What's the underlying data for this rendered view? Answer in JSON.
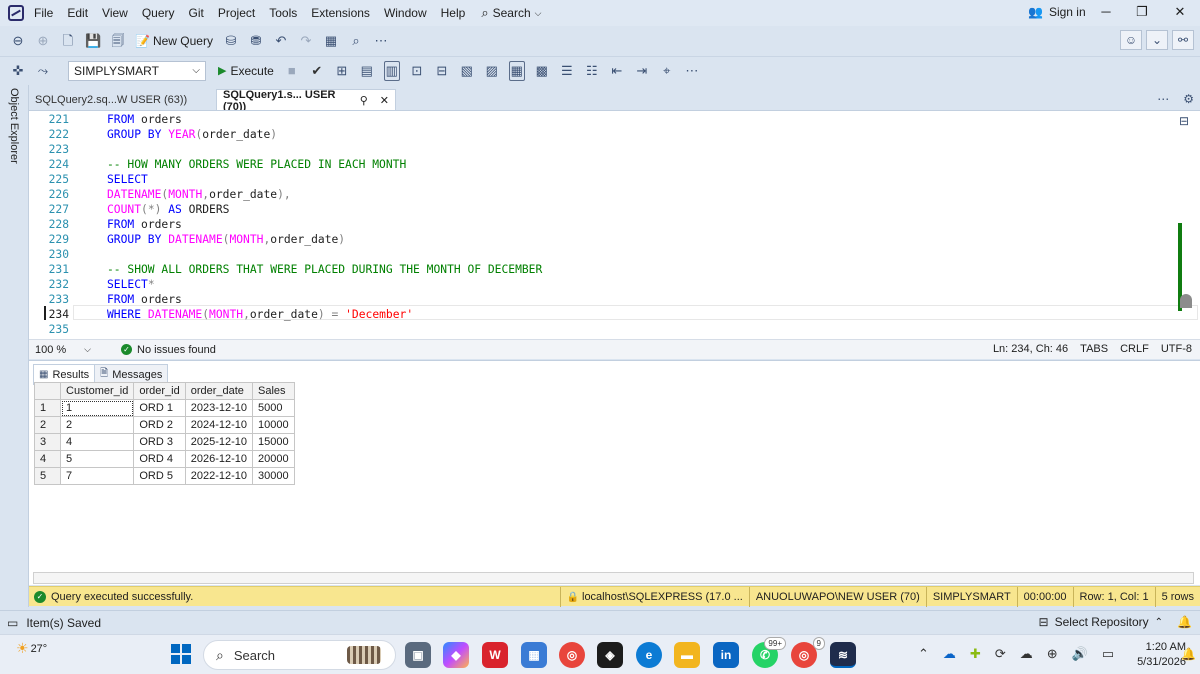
{
  "menubar": {
    "items": [
      "File",
      "Edit",
      "View",
      "Query",
      "Git",
      "Project",
      "Tools",
      "Extensions",
      "Window",
      "Help"
    ],
    "search_label": "Search",
    "sign_in": "Sign in"
  },
  "toolbar": {
    "new_query": "New Query",
    "database": "SIMPLYSMART",
    "execute": "Execute"
  },
  "object_explorer": {
    "label": "Object Explorer"
  },
  "tabs": [
    {
      "label": "SQLQuery2.sq...W USER (63))",
      "active": false
    },
    {
      "label": "SQLQuery1.s... USER (70))",
      "active": true
    }
  ],
  "editor": {
    "lines": [
      {
        "n": "221",
        "code": [
          {
            "t": "FROM",
            "c": "kw"
          },
          {
            "t": " orders",
            "c": "id"
          }
        ]
      },
      {
        "n": "222",
        "code": [
          {
            "t": "GROUP BY ",
            "c": "kw"
          },
          {
            "t": "YEAR",
            "c": "fn"
          },
          {
            "t": "(",
            "c": "op"
          },
          {
            "t": "order_date",
            "c": "id"
          },
          {
            "t": ")",
            "c": "op"
          }
        ]
      },
      {
        "n": "223",
        "code": []
      },
      {
        "n": "224",
        "code": [
          {
            "t": "-- HOW MANY ORDERS WERE PLACED IN EACH MONTH",
            "c": "cm"
          }
        ]
      },
      {
        "n": "225",
        "code": [
          {
            "t": "SELECT",
            "c": "kw"
          }
        ]
      },
      {
        "n": "226",
        "code": [
          {
            "t": "DATENAME",
            "c": "fn"
          },
          {
            "t": "(",
            "c": "op"
          },
          {
            "t": "MONTH",
            "c": "fn"
          },
          {
            "t": ",",
            "c": "op"
          },
          {
            "t": "order_date",
            "c": "id"
          },
          {
            "t": "),",
            "c": "op"
          }
        ]
      },
      {
        "n": "227",
        "code": [
          {
            "t": "COUNT",
            "c": "fn"
          },
          {
            "t": "(*)",
            "c": "op"
          },
          {
            "t": " AS ",
            "c": "kw"
          },
          {
            "t": "ORDERS",
            "c": "id"
          }
        ]
      },
      {
        "n": "228",
        "code": [
          {
            "t": "FROM",
            "c": "kw"
          },
          {
            "t": " orders",
            "c": "id"
          }
        ]
      },
      {
        "n": "229",
        "code": [
          {
            "t": "GROUP BY ",
            "c": "kw"
          },
          {
            "t": "DATENAME",
            "c": "fn"
          },
          {
            "t": "(",
            "c": "op"
          },
          {
            "t": "MONTH",
            "c": "fn"
          },
          {
            "t": ",",
            "c": "op"
          },
          {
            "t": "order_date",
            "c": "id"
          },
          {
            "t": ")",
            "c": "op"
          }
        ]
      },
      {
        "n": "230",
        "code": []
      },
      {
        "n": "231",
        "code": [
          {
            "t": "-- SHOW ALL ORDERS THAT WERE PLACED DURING THE MONTH OF DECEMBER",
            "c": "cm"
          }
        ]
      },
      {
        "n": "232",
        "code": [
          {
            "t": "SELECT",
            "c": "kw"
          },
          {
            "t": "*",
            "c": "op"
          }
        ]
      },
      {
        "n": "233",
        "code": [
          {
            "t": "FROM",
            "c": "kw"
          },
          {
            "t": " orders",
            "c": "id"
          }
        ]
      },
      {
        "n": "234",
        "code": [
          {
            "t": "WHERE ",
            "c": "kw"
          },
          {
            "t": "DATENAME",
            "c": "fn"
          },
          {
            "t": "(",
            "c": "op"
          },
          {
            "t": "MONTH",
            "c": "fn"
          },
          {
            "t": ",",
            "c": "op"
          },
          {
            "t": "order_date",
            "c": "id"
          },
          {
            "t": ") = ",
            "c": "op"
          },
          {
            "t": "'December'",
            "c": "st"
          }
        ],
        "current": true
      },
      {
        "n": "235",
        "code": []
      }
    ]
  },
  "editor_status": {
    "zoom": "100 %",
    "issues": "No issues found",
    "position": "Ln: 234, Ch: 46",
    "indent": "TABS",
    "line_ending": "CRLF",
    "encoding": "UTF-8"
  },
  "results": {
    "tab_results": "Results",
    "tab_messages": "Messages",
    "columns": [
      "Customer_id",
      "order_id",
      "order_date",
      "Sales"
    ],
    "rows": [
      [
        "1",
        "1",
        "ORD 1",
        "2023-12-10",
        "5000"
      ],
      [
        "2",
        "2",
        "ORD 2",
        "2024-12-10",
        "10000"
      ],
      [
        "3",
        "4",
        "ORD 3",
        "2025-12-10",
        "15000"
      ],
      [
        "4",
        "5",
        "ORD 4",
        "2026-12-10",
        "20000"
      ],
      [
        "5",
        "7",
        "ORD 5",
        "2022-12-10",
        "30000"
      ]
    ]
  },
  "query_status": {
    "message": "Query executed successfully.",
    "server": "localhost\\SQLEXPRESS (17.0 ...",
    "user": "ANUOLUWAPO\\NEW USER (70)",
    "database": "SIMPLYSMART",
    "elapsed": "00:00:00",
    "cursor": "Row: 1, Col: 1",
    "row_count": "5 rows",
    "color": "#f8e68f"
  },
  "app_status": {
    "message": "Item(s) Saved",
    "repo": "Select Repository"
  },
  "taskbar": {
    "temperature": "27°",
    "search": "Search",
    "badge_whatsapp": "99+",
    "badge_chrome": "9",
    "time": "1:20 AM",
    "date": "5/31/2026"
  }
}
